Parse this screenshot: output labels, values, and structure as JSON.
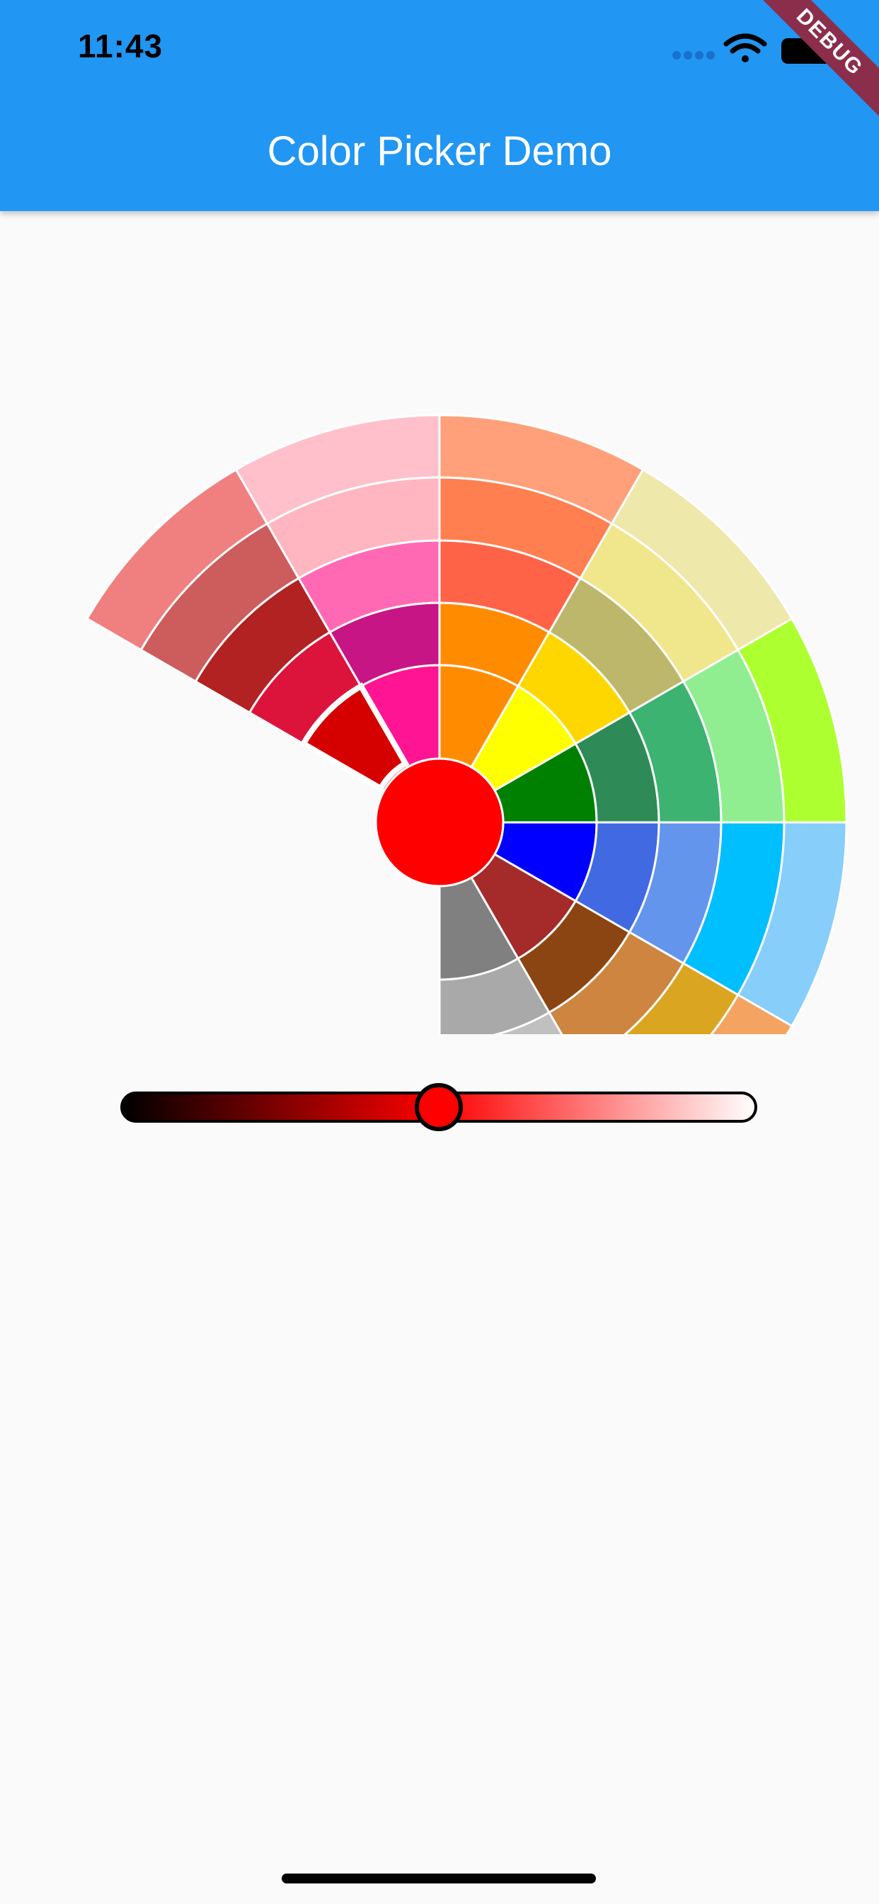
{
  "status_bar": {
    "time": "11:43",
    "icons": [
      "signal-dots-icon",
      "wifi-icon",
      "battery-icon"
    ]
  },
  "app_bar": {
    "title": "Color Picker Demo",
    "color": "#2196F3"
  },
  "debug_banner": {
    "label": "DEBUG",
    "color": "#8B2E4C"
  },
  "color_wheel": {
    "selected_color": "#FF0000",
    "selected_segment": "red-ring-1",
    "hues": [
      {
        "name": "red",
        "shades": [
          "#D50000",
          "#DC143C",
          "#B22222",
          "#CD5C5C",
          "#F08080"
        ]
      },
      {
        "name": "pink",
        "shades": [
          "#FF1493",
          "#C71585",
          "#FF69B4",
          "#FFB6C1",
          "#FFC0CB"
        ]
      },
      {
        "name": "orange-red",
        "shades": [
          "#FF8C00",
          "#FF8C00",
          "#FF6347",
          "#FF7F50",
          "#FFA07A"
        ]
      },
      {
        "name": "yellow",
        "shades": [
          "#FFFF00",
          "#FFD700",
          "#BDB76B",
          "#F0E68C",
          "#EEE8AA"
        ]
      },
      {
        "name": "green",
        "shades": [
          "#008000",
          "#2E8B57",
          "#3CB371",
          "#90EE90",
          "#ADFF2F"
        ]
      },
      {
        "name": "blue",
        "shades": [
          "#0000FF",
          "#4169E1",
          "#6495ED",
          "#00BFFF",
          "#87CEFA"
        ]
      },
      {
        "name": "brown",
        "shades": [
          "#A52A2A",
          "#8B4513",
          "#CD853F",
          "#DAA520",
          "#F4A460"
        ]
      },
      {
        "name": "gray",
        "shades": [
          "#808080",
          "#A9A9A9",
          "#C0C0C0",
          "#D3D3D3",
          "#DCDCDC"
        ]
      }
    ]
  },
  "brightness_slider": {
    "value": 0.5,
    "thumb_color": "#FF0000",
    "gradient": [
      "#000000",
      "#FF0000",
      "#FFFFFF"
    ]
  }
}
